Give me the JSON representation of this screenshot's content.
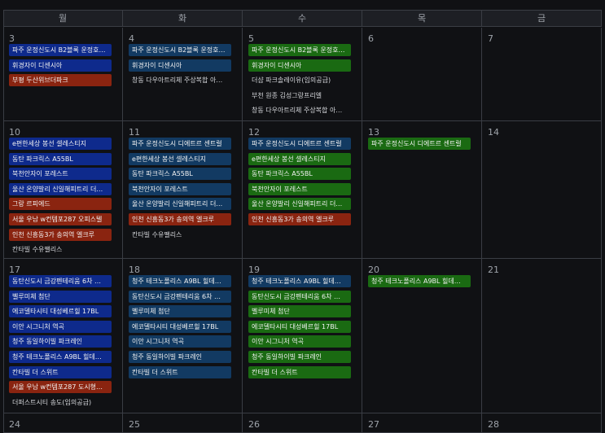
{
  "weekdays": [
    "월",
    "화",
    "수",
    "목",
    "금"
  ],
  "weeks": [
    {
      "days": [
        {
          "num": "3",
          "events": [
            {
              "text": "파주 운정신도시 B2블록 운정호…",
              "color": "blue"
            },
            {
              "text": "휘경자이 디센시아",
              "color": "blue"
            },
            {
              "text": "부평 두산위브더파크",
              "color": "red"
            }
          ]
        },
        {
          "num": "4",
          "events": [
            {
              "text": "파주 운정신도시 B2블록 운정호…",
              "color": "teal"
            },
            {
              "text": "휘경자이 디센시아",
              "color": "teal"
            },
            {
              "text": "창동 다우아트리체 주상복합 아…",
              "color": "none"
            }
          ]
        },
        {
          "num": "5",
          "events": [
            {
              "text": "파주 운정신도시 B2블록 운정호…",
              "color": "green"
            },
            {
              "text": "휘경자이 디센시아",
              "color": "green"
            },
            {
              "text": "더샵 파크솔레이유(임의공급)",
              "color": "none"
            },
            {
              "text": "부천 원종 김성그랑프리엘",
              "color": "none"
            },
            {
              "text": "창동 다우아트리체 주상복합 아…",
              "color": "none"
            }
          ]
        },
        {
          "num": "6",
          "events": []
        },
        {
          "num": "7",
          "events": []
        }
      ]
    },
    {
      "days": [
        {
          "num": "10",
          "events": [
            {
              "text": "e편한세상 봉선 셀레스티지",
              "color": "blue"
            },
            {
              "text": "동탄 파크릭스 A55BL",
              "color": "blue"
            },
            {
              "text": "북천안자이 포레스트",
              "color": "blue"
            },
            {
              "text": "울산 온양발리 신일해피트리 더…",
              "color": "blue"
            },
            {
              "text": "그랑 르피에드",
              "color": "red"
            },
            {
              "text": "서울 우남 w컨템포287 오피스텔",
              "color": "red"
            },
            {
              "text": "인천 신흥동3가 송의역 엘크루",
              "color": "red"
            },
            {
              "text": "칸타빌 수유팰리스",
              "color": "none"
            }
          ]
        },
        {
          "num": "11",
          "events": [
            {
              "text": "파주 운정신도시 디에트르 센트럴",
              "color": "teal"
            },
            {
              "text": "e편한세상 봉선 셀레스티지",
              "color": "teal"
            },
            {
              "text": "동탄 파크릭스 A55BL",
              "color": "teal"
            },
            {
              "text": "북천안자이 포레스트",
              "color": "teal"
            },
            {
              "text": "울산 온양발리 신일해피트리 더…",
              "color": "teal"
            },
            {
              "text": "인천 신흥동3가 송의역 엘크루",
              "color": "red"
            },
            {
              "text": "칸타빌 수유팰리스",
              "color": "none"
            }
          ]
        },
        {
          "num": "12",
          "events": [
            {
              "text": "파주 운정신도시 디에트르 센트럴",
              "color": "teal"
            },
            {
              "text": "e편한세상 봉선 셀레스티지",
              "color": "green"
            },
            {
              "text": "동탄 파크릭스 A55BL",
              "color": "green"
            },
            {
              "text": "북천안자이 포레스트",
              "color": "green"
            },
            {
              "text": "울산 온양발리 신일해피트리 더…",
              "color": "green"
            },
            {
              "text": "인천 신흥동3가 송의역 엘크루",
              "color": "red"
            }
          ]
        },
        {
          "num": "13",
          "events": [
            {
              "text": "파주 운정신도시 디에트르 센트럴",
              "color": "green"
            }
          ]
        },
        {
          "num": "14",
          "events": []
        }
      ]
    },
    {
      "days": [
        {
          "num": "17",
          "events": [
            {
              "text": "동탄신도시 금강펜테리움 6차 …",
              "color": "blue"
            },
            {
              "text": "벨루미체 첨단",
              "color": "blue"
            },
            {
              "text": "에코델타시티 대성베르힐 17BL",
              "color": "blue"
            },
            {
              "text": "이안 시그니처 역곡",
              "color": "blue"
            },
            {
              "text": "청주 동일하이빌 파크레인",
              "color": "blue"
            },
            {
              "text": "청주 테크노폴리스 A9BL 힐데…",
              "color": "blue"
            },
            {
              "text": "칸타빌 더 스위트",
              "color": "blue"
            },
            {
              "text": "서울 우남 w컨템포287 도시형…",
              "color": "red"
            },
            {
              "text": "더퍼스트시티 송도(임의공급)",
              "color": "none"
            }
          ]
        },
        {
          "num": "18",
          "events": [
            {
              "text": "청주 테크노폴리스 A9BL 힐데…",
              "color": "teal"
            },
            {
              "text": "동탄신도시 금강펜테리움 6차 …",
              "color": "teal"
            },
            {
              "text": "벨루미체 첨단",
              "color": "teal"
            },
            {
              "text": "에코델타시티 대성베르힐 17BL",
              "color": "teal"
            },
            {
              "text": "이안 시그니처 역곡",
              "color": "teal"
            },
            {
              "text": "청주 동일하이빌 파크레인",
              "color": "teal"
            },
            {
              "text": "칸타빌 더 스위트",
              "color": "teal"
            }
          ]
        },
        {
          "num": "19",
          "events": [
            {
              "text": "청주 테크노폴리스 A9BL 힐데…",
              "color": "teal"
            },
            {
              "text": "동탄신도시 금강펜테리움 6차 …",
              "color": "green"
            },
            {
              "text": "벨루미체 첨단",
              "color": "green"
            },
            {
              "text": "에코델타시티 대성베르힐 17BL",
              "color": "green"
            },
            {
              "text": "이안 시그니처 역곡",
              "color": "green"
            },
            {
              "text": "청주 동일하이빌 파크레인",
              "color": "green"
            },
            {
              "text": "칸타빌 더 스위트",
              "color": "green"
            }
          ]
        },
        {
          "num": "20",
          "events": [
            {
              "text": "청주 테크노폴리스 A9BL 힐데…",
              "color": "green"
            }
          ]
        },
        {
          "num": "21",
          "events": []
        }
      ]
    },
    {
      "days": [
        {
          "num": "24",
          "events": []
        },
        {
          "num": "25",
          "events": []
        },
        {
          "num": "26",
          "events": []
        },
        {
          "num": "27",
          "events": []
        },
        {
          "num": "28",
          "events": []
        }
      ]
    }
  ]
}
